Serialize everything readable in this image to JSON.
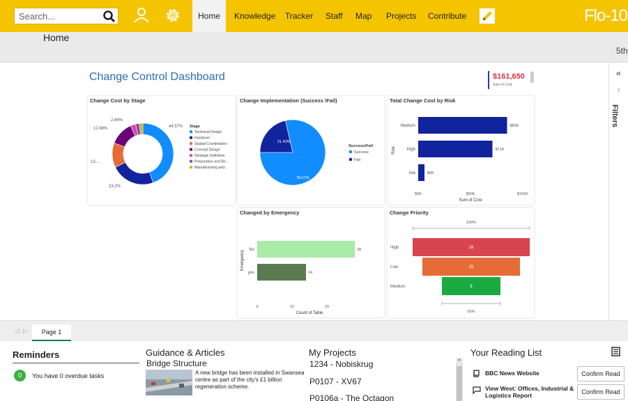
{
  "nav": {
    "search_placeholder": "Search...",
    "items": [
      "Home",
      "Knowledge",
      "Tracker",
      "Staff",
      "Map",
      "Projects",
      "Contribute"
    ],
    "active": "Home",
    "brand": "Flo-10"
  },
  "header": {
    "page_title": "Home",
    "date_fragment": "5th"
  },
  "dashboard": {
    "title": "Change Control Dashboard",
    "kpi_value": "$161,650",
    "kpi_label": "Sum of Cost"
  },
  "filters": {
    "label": "Filters",
    "collapse_glyph": "«"
  },
  "chart_data": [
    {
      "id": "cost-by-stage",
      "type": "pie",
      "title": "Change Cost by Stage",
      "legend_title": "Stage",
      "legend": [
        "Technical Design",
        "Handover",
        "Spatial Coordination",
        "Concept Design",
        "Strategic Definition",
        "Preparation and Bri...",
        "Manufacturing and..."
      ],
      "values": [
        44.57,
        23.2,
        13.0,
        12.68,
        2.66,
        2.0,
        1.89
      ],
      "labels": [
        "44.57%",
        "23.2%",
        "13....",
        "12.68%",
        "2.66%"
      ],
      "colors": [
        "#118dff",
        "#12239e",
        "#e66c37",
        "#6b007b",
        "#e044a7",
        "#744ec2",
        "#d9b300"
      ]
    },
    {
      "id": "implementation",
      "type": "pie",
      "title": "Change Implementation (Success \\Fail)",
      "legend_title": "Success\\Fail",
      "legend": [
        "Success",
        "Fail"
      ],
      "values": [
        78.57,
        21.43
      ],
      "labels": [
        "78.57%",
        "21.43%"
      ],
      "colors": [
        "#118dff",
        "#12239e"
      ]
    },
    {
      "id": "cost-by-risk",
      "type": "bar",
      "title": "Total Change Cost by Risk",
      "categories": [
        "Medium",
        "High",
        "low"
      ],
      "values": [
        85,
        71,
        6
      ],
      "value_labels": [
        "$85K",
        "$71K",
        "$6K"
      ],
      "xticks": [
        "$0K",
        "$50K",
        "$100K"
      ],
      "xlim": [
        0,
        100
      ],
      "xlabel": "Sum of Cost",
      "ylabel": "Risk",
      "color": "#12239e"
    },
    {
      "id": "emergency",
      "type": "bar",
      "title": "Changed by Emergency",
      "categories": [
        "No",
        "yes"
      ],
      "values": [
        28,
        14
      ],
      "value_labels": [
        "28",
        "14"
      ],
      "xticks": [
        "0",
        "10",
        "20"
      ],
      "xlim": [
        0,
        30
      ],
      "xlabel": "Count of Table",
      "ylabel": "Emergency",
      "colors": [
        "#a9eba9",
        "#5a7a50"
      ]
    },
    {
      "id": "priority",
      "type": "bar",
      "title": "Change Priority",
      "categories": [
        "High",
        "Low",
        "Medium"
      ],
      "values": [
        18,
        15,
        9
      ],
      "value_labels": [
        "18",
        "15",
        "9"
      ],
      "top_label": "100%",
      "bottom_label": "50%",
      "colors": [
        "#d64550",
        "#e66c37",
        "#1aab40"
      ]
    }
  ],
  "tabs": {
    "page": "Page 1"
  },
  "reminders": {
    "title": "Reminders",
    "count": "0",
    "text": "You have 0 overdue tasks"
  },
  "guidance": {
    "title": "Guidance & Articles",
    "article_title": "Bridge Structure",
    "article_body": "A new bridge has been installed in Swansea centre as part of the city's £1 billion regeneration scheme."
  },
  "projects": {
    "title": "My Projects",
    "items": [
      "1234 - Nobiskrug",
      "P0107 - XV67",
      "P0106a - The Octagon"
    ]
  },
  "reading": {
    "title": "Your Reading List",
    "items": [
      {
        "title": "BBC News Website",
        "button": "Confirm Read"
      },
      {
        "title": "View West: Offices, Industrial & Logistics Report",
        "button": "Confirm Read"
      }
    ]
  }
}
